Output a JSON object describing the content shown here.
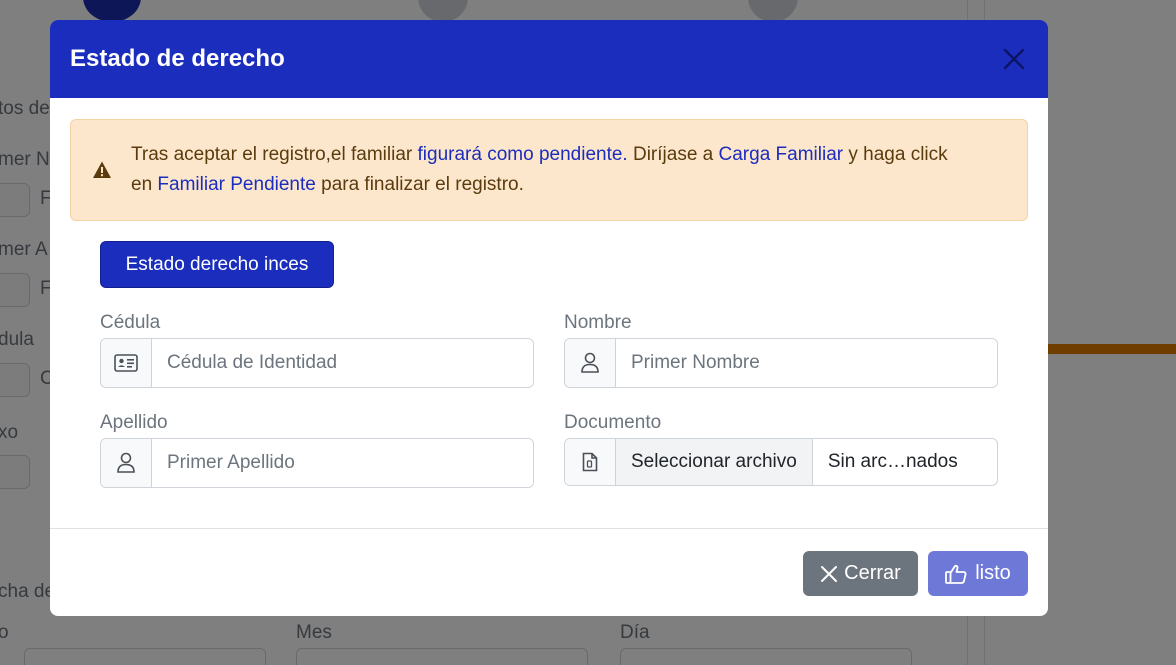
{
  "background": {
    "labels": [
      "tos de",
      "mer N",
      "mer A",
      "dula",
      "xo",
      "cha de",
      "o",
      "Mes",
      "Día"
    ],
    "input_stubs": [
      "F",
      "F",
      "C"
    ]
  },
  "modal": {
    "title": "Estado de derecho",
    "alert": {
      "text_1": "Tras aceptar el registro,el familiar ",
      "link_1": "figurará como pendiente.",
      "text_2": " Diríjase a ",
      "link_2": "Carga Familiar",
      "text_3": " y haga click en ",
      "link_3": "Familiar Pendiente",
      "text_4": " para finalizar el registro."
    },
    "primary_button": "Estado derecho inces",
    "fields": {
      "cedula": {
        "label": "Cédula",
        "placeholder": "Cédula de Identidad"
      },
      "nombre": {
        "label": "Nombre",
        "placeholder": "Primer Nombre"
      },
      "apellido": {
        "label": "Apellido",
        "placeholder": "Primer Apellido"
      },
      "documento": {
        "label": "Documento",
        "button": "Seleccionar archivo",
        "file_name": "Sin arc…nados"
      }
    },
    "footer": {
      "close_label": "Cerrar",
      "ok_label": "listo"
    }
  },
  "colors": {
    "header": "#1a2dbd",
    "alert_bg": "#fde7cc",
    "secondary": "#6c757d",
    "ok_button": "#6e78d6",
    "accent_orange": "#e07b00"
  }
}
